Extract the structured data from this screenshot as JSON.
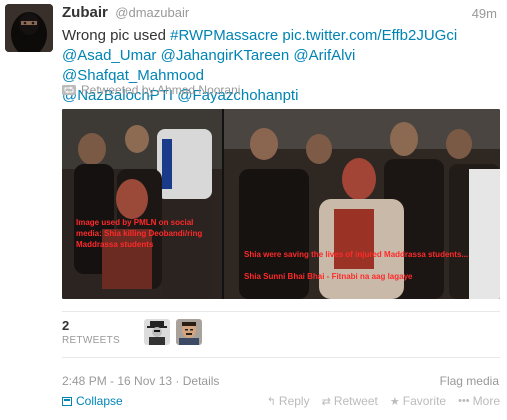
{
  "author": {
    "name": "Zubair",
    "handle": "@dmazubair",
    "timestamp": "49m"
  },
  "tweet": {
    "prefix": "Wrong pic used ",
    "hashtag1": "#RWPMassacre",
    "link": "pic.twitter.com/Effb2JUGci",
    "mentions": [
      "@Asad_Umar",
      "@JahangirKTareen",
      "@ArifAlvi",
      "@Shafqat_Mahmood",
      "@NazBalochPTI",
      "@Fayazchohanpti"
    ]
  },
  "retweeted_by": "Retweeted by Ahmad Noorani",
  "media": {
    "caption_left": "Image used by PMLN on social media: Shia killing Deobandi/ring Maddrassa students",
    "caption_right_1": "Shia were saving the lives of injured Maddrassa students...",
    "caption_right_2": "Shia Sunni Bhai Bhai - Fitnabi na aag lagaye"
  },
  "stats": {
    "retweet_count": "2",
    "retweet_label": "RETWEETS"
  },
  "meta": {
    "timestamp": "2:48 PM - 16 Nov 13",
    "separator": " · ",
    "details": "Details",
    "flag": "Flag media"
  },
  "footer": {
    "collapse": "Collapse",
    "reply": "Reply",
    "retweet": "Retweet",
    "favorite": "Favorite",
    "more": "More"
  },
  "icons": {
    "collapse": "collapse-icon",
    "reply": "reply-icon",
    "retweet": "retweet-icon",
    "favorite": "star-icon",
    "more": "more-icon"
  },
  "colors": {
    "link": "#0084b4",
    "muted": "#999999",
    "caption": "#ff2a2a"
  }
}
